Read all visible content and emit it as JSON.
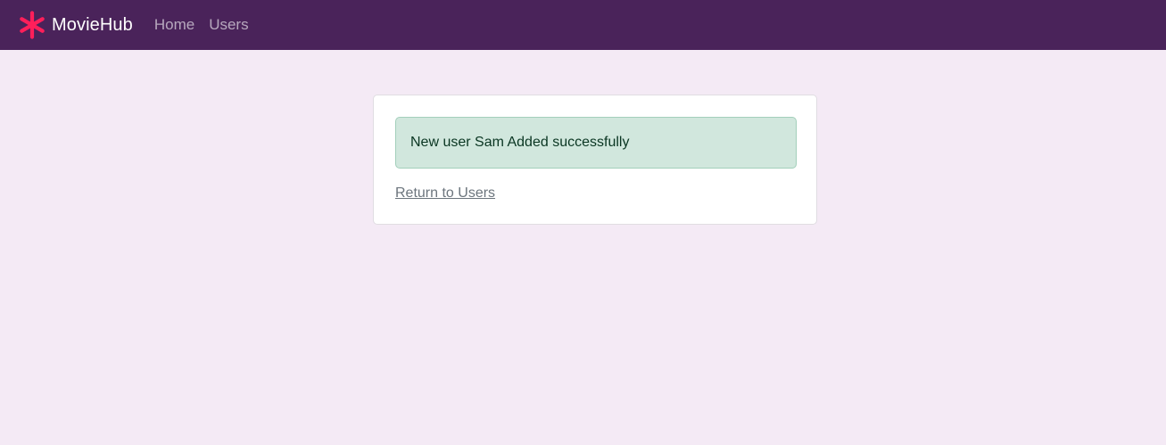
{
  "navbar": {
    "brand": "MovieHub",
    "brand_icon": "asterisk-logo-icon",
    "links": [
      {
        "label": "Home"
      },
      {
        "label": "Users"
      }
    ],
    "background": "#4a235a",
    "logo_color": "#ff1f5a"
  },
  "main": {
    "alert": {
      "message": "New user Sam Added successfully",
      "type": "success"
    },
    "return_link": "Return to Users"
  }
}
